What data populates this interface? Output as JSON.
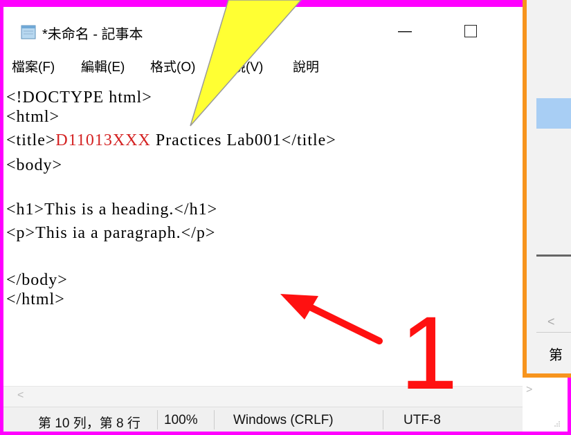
{
  "window": {
    "title": "*未命名 - 記事本",
    "minimize_glyph": "—"
  },
  "menu": [
    "檔案(F)",
    "編輯(E)",
    "格式(O)",
    "檢視(V)",
    "說明"
  ],
  "editor": {
    "lines": [
      {
        "pre": "<!DOCTYPE html>",
        "red": "",
        "post": ""
      },
      {
        "pre": "<html>",
        "red": "",
        "post": ""
      },
      {
        "pre": "<title>",
        "red": "D11013XXX",
        "post": " Practices Lab001</title>"
      },
      {
        "pre": "<body>",
        "red": "",
        "post": ""
      },
      {
        "pre": "",
        "red": "",
        "post": ""
      },
      {
        "pre": "<h1>This is a heading.</h1>",
        "red": "",
        "post": ""
      },
      {
        "pre": "<p>This ia a paragraph.</p>",
        "red": "",
        "post": ""
      },
      {
        "pre": "",
        "red": "",
        "post": ""
      },
      {
        "pre": "</body>",
        "red": "",
        "post": ""
      },
      {
        "pre": "</html>",
        "red": "",
        "post": ""
      }
    ]
  },
  "statusbar": {
    "position": "第 10 列，第 8 行",
    "zoom": "100%",
    "line_ending": "Windows (CRLF)",
    "encoding": "UTF-8"
  },
  "background_window": {
    "status_char": "第"
  },
  "annotation": {
    "number": "1"
  },
  "colors": {
    "frame": "#ff00ff",
    "accent_orange": "#f7941d",
    "highlight_red": "#d42222",
    "arrow_red": "#ff1111",
    "callout_yellow": "#ffff33"
  },
  "icons": {
    "app": "notepad-icon",
    "minimize": "minimize-icon",
    "maximize": "maximize-icon",
    "scroll_left": "chevron-left-icon",
    "scroll_right": "chevron-right-icon",
    "resize": "resize-grip-icon"
  }
}
